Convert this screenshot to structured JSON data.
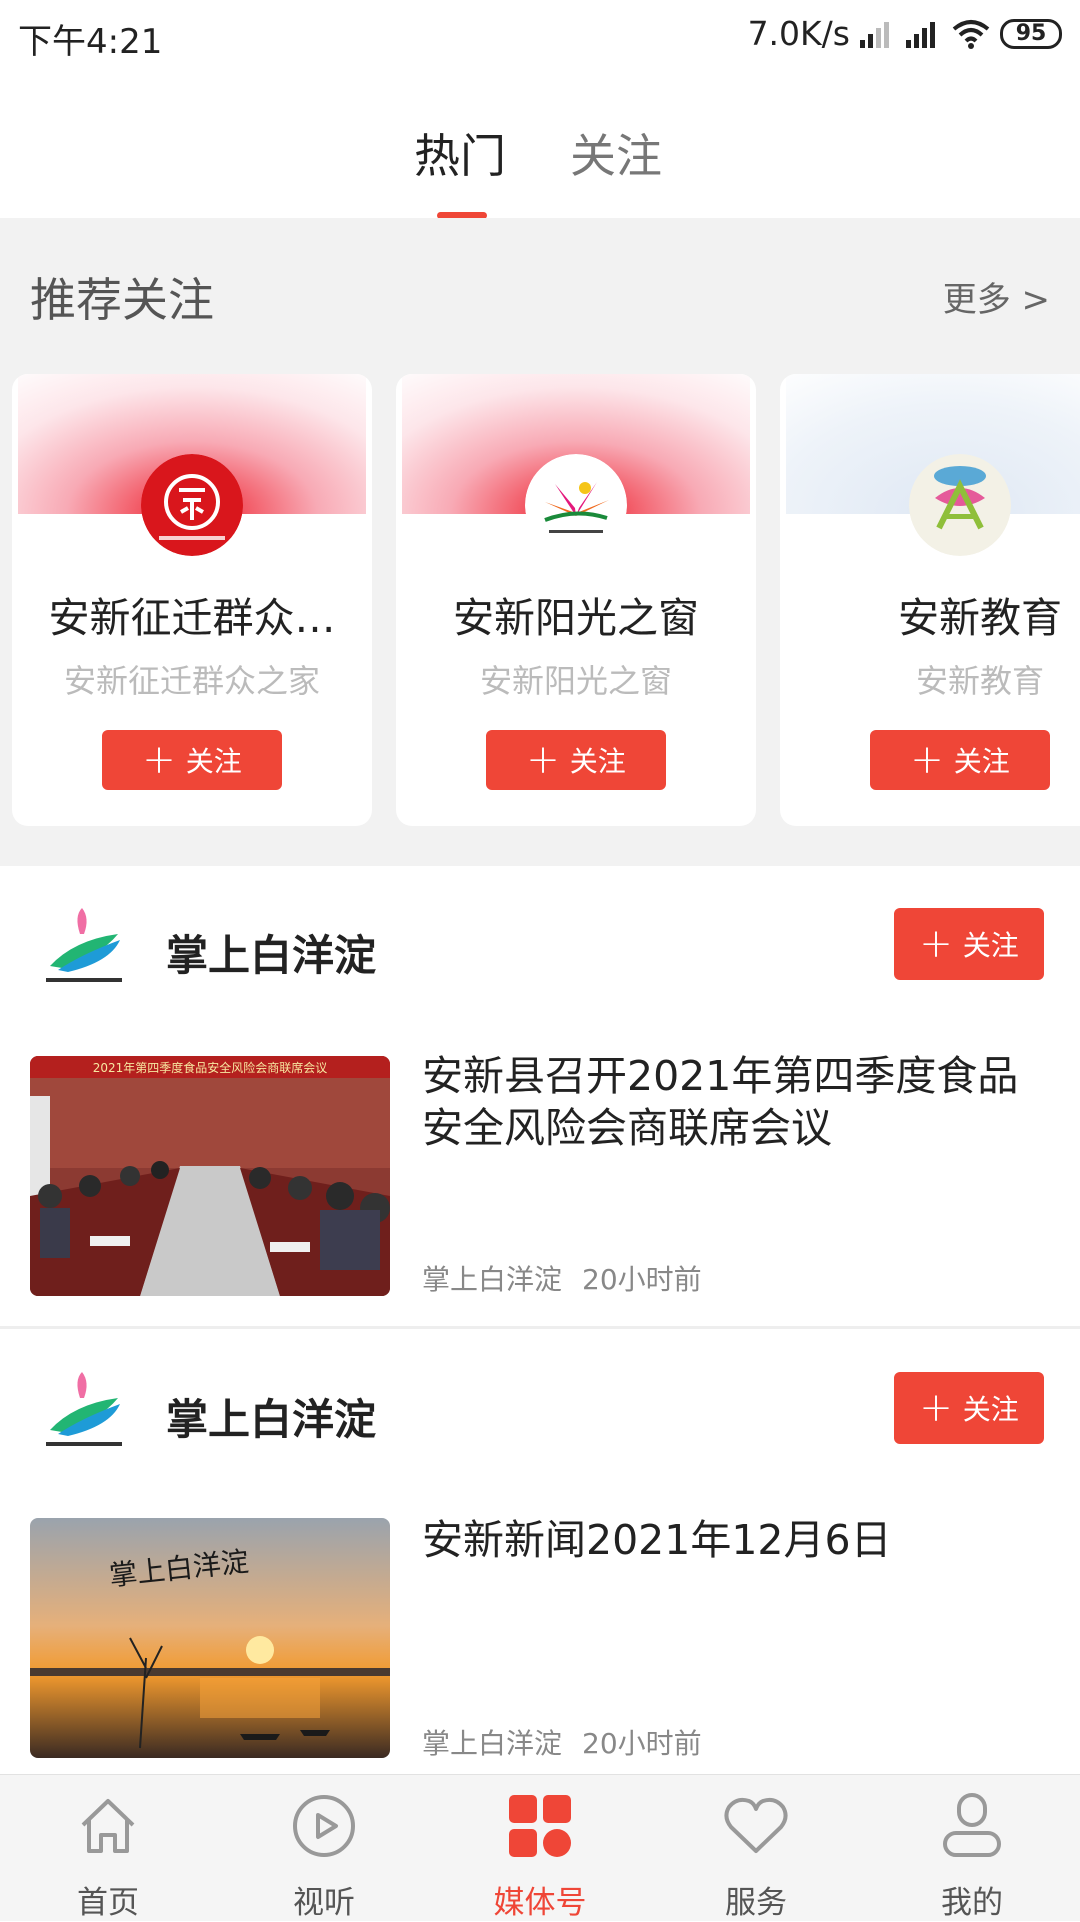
{
  "status_bar": {
    "time": "下午4:21",
    "speed": "7.0K/s",
    "battery": "95"
  },
  "tabs": [
    {
      "label": "热门"
    },
    {
      "label": "关注"
    }
  ],
  "recommend": {
    "title": "推荐关注",
    "more": "更多 >",
    "cards": [
      {
        "name": "安新征迁群众…",
        "desc": "安新征迁群众之家",
        "button": "关注"
      },
      {
        "name": "安新阳光之窗",
        "desc": "安新阳光之窗",
        "button": "关注"
      },
      {
        "name": "安新教育",
        "desc": "安新教育",
        "button": "关注"
      }
    ]
  },
  "articles": [
    {
      "source": "掌上白洋淀",
      "follow": "关注",
      "title": "安新县召开2021年第四季度食品安全风险会商联席会议",
      "meta_source": "掌上白洋淀",
      "meta_time": "20小时前",
      "thumb_text": "2021年第四季度食品安全风险会商联席会议"
    },
    {
      "source": "掌上白洋淀",
      "follow": "关注",
      "title": "安新新闻2021年12月6日",
      "meta_source": "掌上白洋淀",
      "meta_time": "20小时前",
      "thumb_text": "掌上白洋淀"
    }
  ],
  "bottom_nav": [
    {
      "label": "首页",
      "icon": "home-icon"
    },
    {
      "label": "视听",
      "icon": "play-circle-icon"
    },
    {
      "label": "媒体号",
      "icon": "grid-icon",
      "active": true
    },
    {
      "label": "服务",
      "icon": "heart-icon"
    },
    {
      "label": "我的",
      "icon": "person-icon"
    }
  ],
  "colors": {
    "accent": "#ef4637"
  }
}
